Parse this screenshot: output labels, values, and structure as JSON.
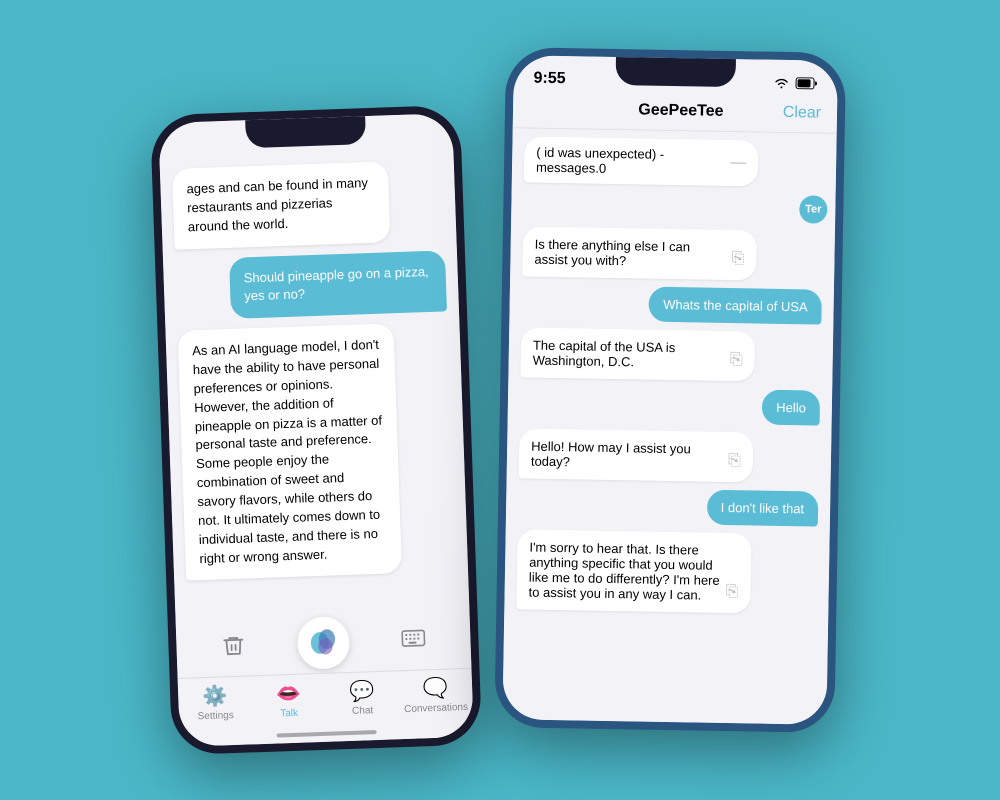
{
  "background": "#4ab8c8",
  "left_phone": {
    "messages": [
      {
        "type": "ai",
        "text": "ages and can be found in many restaurants and pizzerias around the world."
      },
      {
        "type": "user",
        "text": "Should pineapple go on a pizza, yes or no?"
      },
      {
        "type": "ai",
        "text": "As an AI language model, I don't have the ability to have personal preferences or opinions. However, the addition of pineapple on pizza is a matter of personal taste and preference. Some people enjoy the combination of sweet and savory flavors, while others do not. It ultimately comes down to individual taste, and there is no right or wrong answer."
      }
    ],
    "tabs": [
      {
        "label": "Settings",
        "icon": "⚙"
      },
      {
        "label": "Talk",
        "icon": "👄",
        "active": true
      },
      {
        "label": "Chat",
        "icon": "💬"
      },
      {
        "label": "Conversations",
        "icon": "🗨"
      }
    ]
  },
  "right_phone": {
    "time": "9:55",
    "title": "GeePeeTee",
    "clear_label": "Clear",
    "messages": [
      {
        "type": "partial_ai",
        "text": "( id  was unexpected) - messages.0"
      },
      {
        "type": "avatar",
        "initials": "Ter"
      },
      {
        "type": "ai",
        "text": "Is there anything else I can assist you with?"
      },
      {
        "type": "user",
        "text": "Whats the capital of USA"
      },
      {
        "type": "ai",
        "text": "The capital of the USA is Washington, D.C."
      },
      {
        "type": "user",
        "text": "Hello"
      },
      {
        "type": "ai",
        "text": "Hello! How may I assist you today?"
      },
      {
        "type": "user",
        "text": "I don't like that"
      },
      {
        "type": "ai",
        "text": "I'm sorry to hear that. Is there anything specific that you would like me to do differently? I'm here to assist you in any way I can."
      }
    ]
  }
}
